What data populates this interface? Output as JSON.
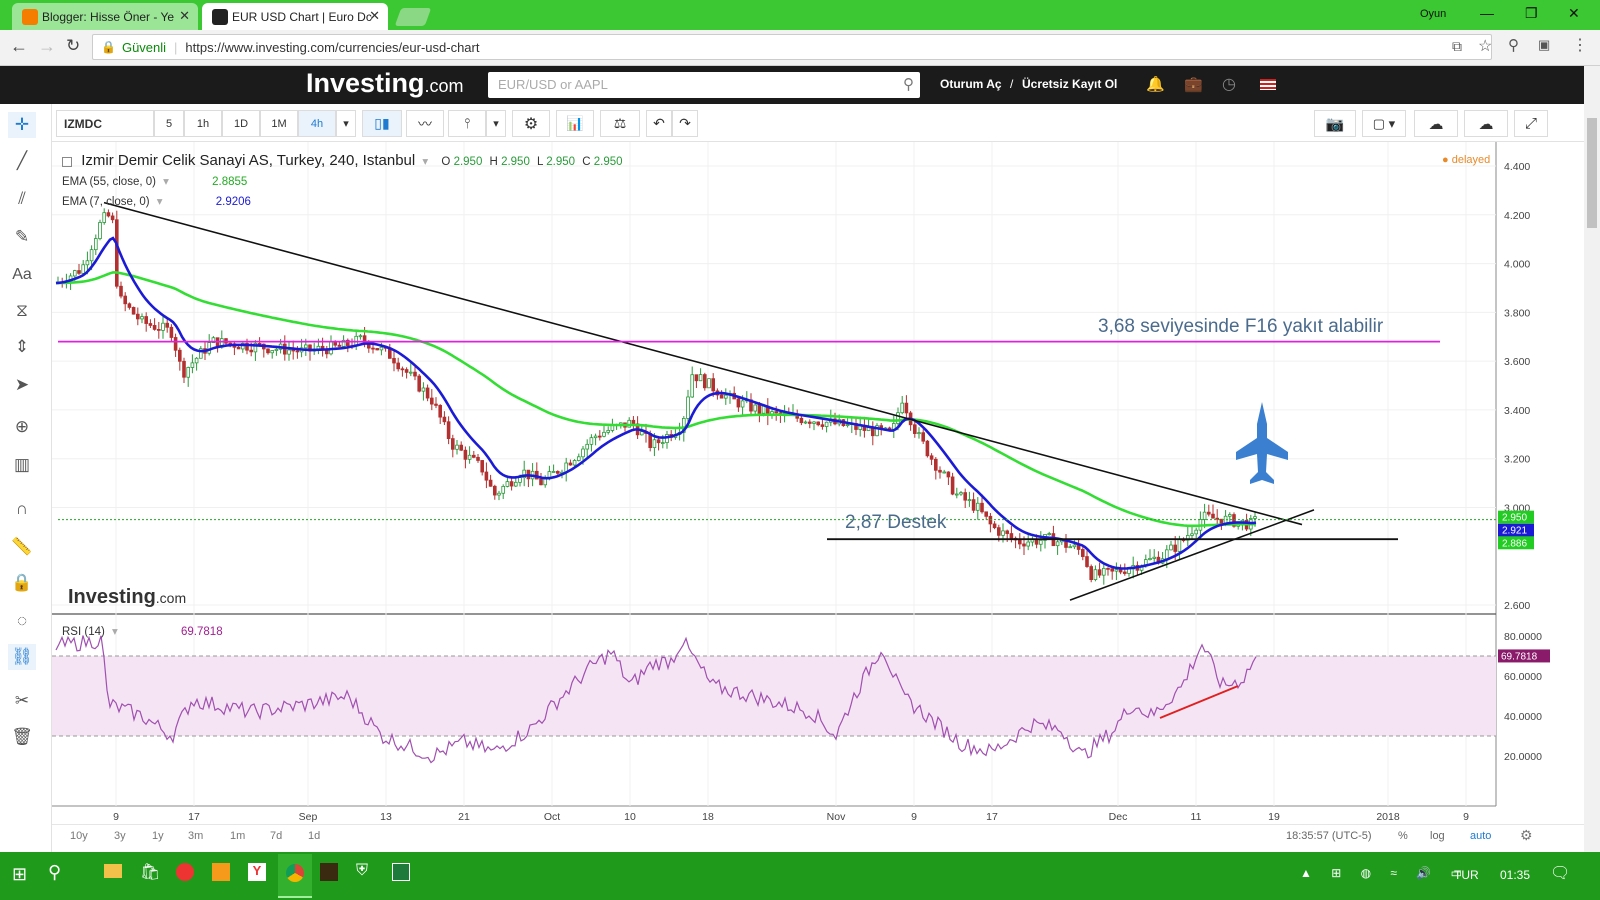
{
  "browser": {
    "tabs": [
      {
        "label": "Blogger: Hisse Öner - Ye"
      },
      {
        "label": "EUR USD Chart | Euro Dc"
      }
    ],
    "profile": "Oyun",
    "secure_label": "Güvenli",
    "url": "https://www.investing.com/currencies/eur-usd-chart"
  },
  "site": {
    "logo_main": "Investing",
    "logo_suffix": ".com",
    "search_placeholder": "EUR/USD or AAPL",
    "login": "Oturum Aç",
    "separator": "/",
    "register": "Ücretsiz Kayıt Ol"
  },
  "toolbar": {
    "symbol": "IZMDC",
    "intervals": [
      "5",
      "1h",
      "1D",
      "1M",
      "4h"
    ]
  },
  "chart": {
    "title": "Izmir Demir Celik Sanayi AS, Turkey, 240, Istanbul",
    "ohlc": {
      "o_label": "O",
      "o": "2.950",
      "h_label": "H",
      "h": "2.950",
      "l_label": "L",
      "l": "2.950",
      "c_label": "C",
      "c": "2.950"
    },
    "ema55_label": "EMA (55, close, 0)",
    "ema55_value": "2.8855",
    "ema7_label": "EMA (7, close, 0)",
    "ema7_value": "2.9206",
    "delayed": "delayed",
    "annotation_f16": "3,68 seviyesinde F16 yakıt alabilir",
    "annotation_support": "2,87 Destek",
    "watermark_main": "Investing",
    "watermark_suffix": ".com",
    "price_ticks": [
      "4.400",
      "4.200",
      "4.000",
      "3.800",
      "3.600",
      "3.400",
      "3.200",
      "3.000",
      "2.600"
    ],
    "price_badges": {
      "last": "2.950",
      "ema7": "2.921",
      "ema55": "2.886"
    },
    "rsi_label": "RSI (14)",
    "rsi_value": "69.7818",
    "rsi_ticks": [
      "80.0000",
      "60.0000",
      "40.0000",
      "20.0000"
    ],
    "rsi_badge": "69.7818",
    "x_ticks": [
      "9",
      "17",
      "Sep",
      "13",
      "21",
      "Oct",
      "10",
      "18",
      "Nov",
      "9",
      "17",
      "Dec",
      "11",
      "19",
      "2018",
      "9"
    ],
    "ranges": [
      "10y",
      "3y",
      "1y",
      "3m",
      "1m",
      "7d",
      "1d"
    ],
    "clock": "18:35:57 (UTC-5)",
    "pct": "%",
    "log": "log",
    "auto": "auto",
    "colors": {
      "ema55": "#33dd33",
      "ema7": "#1b1bd6",
      "resistance": "#e020e0",
      "rsi": "#a050b0",
      "rsi_band": "#f5e4f3",
      "up": "#2a9a3a",
      "down": "#b33030"
    }
  },
  "taskbar": {
    "lang": "TUR",
    "time": "01:35"
  }
}
